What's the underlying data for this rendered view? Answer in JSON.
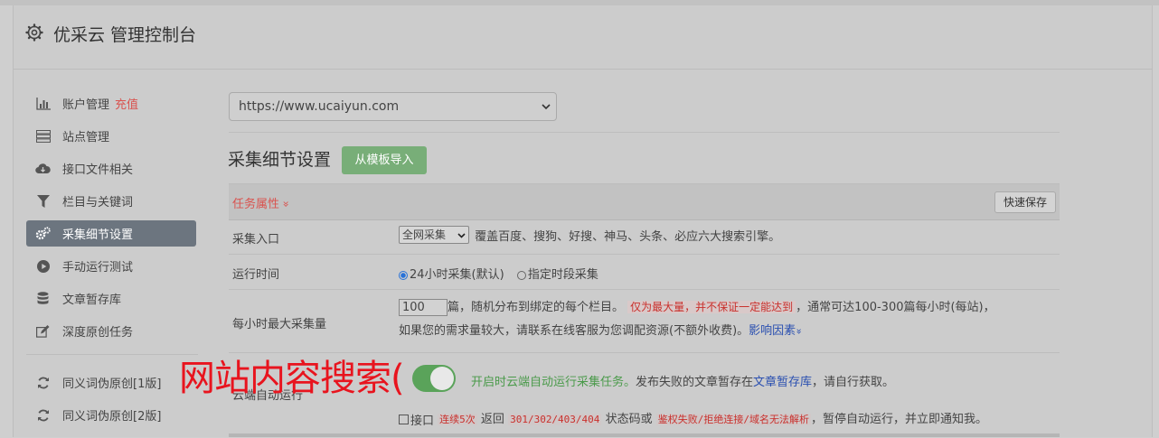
{
  "header": {
    "title": "优采云 管理控制台",
    "icon": "gear-icon"
  },
  "sidebar": {
    "items": [
      {
        "label": "账户管理",
        "extra": "充值",
        "icon": "bar-chart-icon"
      },
      {
        "label": "站点管理",
        "icon": "server-icon"
      },
      {
        "label": "接口文件相关",
        "icon": "cloud-download-icon"
      },
      {
        "label": "栏目与关键词",
        "icon": "filter-icon"
      },
      {
        "label": "采集细节设置",
        "icon": "gears-icon",
        "active": true
      },
      {
        "label": "手动运行测试",
        "icon": "play-circle-icon"
      },
      {
        "label": "文章暂存库",
        "icon": "database-icon"
      },
      {
        "label": "深度原创任务",
        "icon": "edit-icon"
      },
      {
        "label": "同义词伪原创[1版]",
        "icon": "refresh-icon"
      },
      {
        "label": "同义词伪原创[2版]",
        "icon": "refresh-icon"
      }
    ]
  },
  "site_select": {
    "value": "https://www.ucaiyun.com"
  },
  "section": {
    "title": "采集细节设置",
    "import_button": "从模板导入"
  },
  "table": {
    "head": {
      "label": "任务属性",
      "chevron": "»",
      "save_button": "快速保存"
    },
    "entry": {
      "label": "采集入口",
      "select_value": "全网采集",
      "desc": "覆盖百度、搜狗、好搜、神马、头条、必应六大搜索引擎。"
    },
    "runtime": {
      "label": "运行时间",
      "opt1": "24小时采集(默认)",
      "opt2": "指定时段采集"
    },
    "maxper": {
      "label": "每小时最大采集量",
      "value": "100",
      "text1": "篇，随机分布到绑定的每个栏目。",
      "warn": "仅为最大量，并不保证一定能达到",
      "text2": "，通常可达100-300篇每小时(每站)，",
      "text3": "如果您的需求量较大，请联系在线客服为您调配资源(不额外收费)。",
      "link": "影响因素"
    },
    "cloud": {
      "label": "云端自动运行",
      "green_text": "开启时云端自动运行采集任务。",
      "text1": "发布失败的文章暂存在",
      "link": "文章暂存库",
      "text2": "，请自行获取。",
      "check_label": "接口",
      "warn1": "连续5次",
      "text3": "返回",
      "codes": "301/302/403/404",
      "text4": "状态码或",
      "warn2": "鉴权失败/拒绝连接/域名无法解析",
      "text5": "，暂停自动运行，并立即通知我。"
    }
  },
  "overlay": {
    "text": "网站内容搜索("
  },
  "colors": {
    "accent_green": "#78ae78",
    "warn_red": "#d9534f",
    "active_bg": "#6c757f",
    "overlay_red": "#e8141e"
  }
}
